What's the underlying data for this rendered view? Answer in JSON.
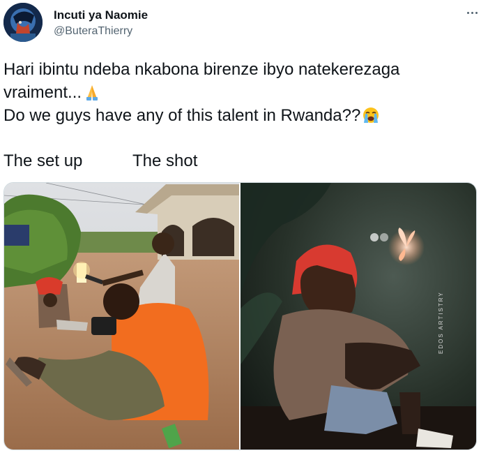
{
  "tweet": {
    "author": {
      "display_name": "Incuti ya Naomie",
      "handle": "@ButeraThierry"
    },
    "text_line1": "Hari ibintu ndeba nkabona birenze ibyo natekerezaga vraiment...",
    "text_line2": "Do we guys have any of this talent in Rwanda??",
    "emoji_1": "folded-hands-emoji",
    "emoji_2": "loudly-crying-face-emoji",
    "label_setup": "The set up",
    "label_shot": "The shot"
  },
  "media": {
    "photo_1": "behind-the-scenes photo: photographer shooting a child in a red hat with a phone light held by another boy",
    "photo_2": "edited photo: child in red hat gazing at a glowing butterfly against a dark green background",
    "watermark": "EDOS ARTISTRY"
  },
  "icons": {
    "more": "more-options-icon"
  },
  "colors": {
    "text": "#0f1419",
    "secondary": "#536471",
    "border": "#cfd9de"
  }
}
